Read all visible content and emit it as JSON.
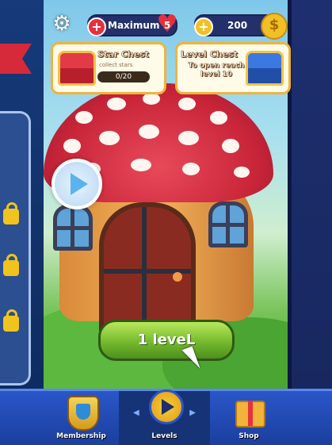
{
  "hud": {
    "health_label": "Maximum",
    "health_count": "5",
    "coins": "200",
    "plus": "+"
  },
  "chests": {
    "star": {
      "title": "Star Chest",
      "subtitle": "collect stars",
      "progress": "0/20"
    },
    "level": {
      "title": "Level Chest",
      "description": "To open reach level 10"
    }
  },
  "main": {
    "level_button": "1 leveL"
  },
  "nav": {
    "membership": "Membership",
    "levels": "Levels",
    "shop": "Shop",
    "left_arrow": "◀",
    "right_arrow": "▶"
  },
  "colors": {
    "health_red": "#e5313e",
    "coin_gold": "#f2c026",
    "button_green": "#6fb52a",
    "nav_blue": "#2a56c9"
  }
}
